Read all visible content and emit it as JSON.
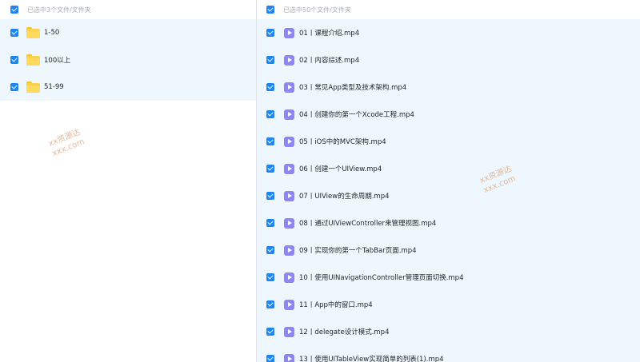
{
  "left": {
    "header": "已选中3个文件/文件夹",
    "items": [
      {
        "name": "1-50"
      },
      {
        "name": "100以上"
      },
      {
        "name": "51-99"
      }
    ]
  },
  "right": {
    "header": "已选中50个文件/文件夹",
    "items": [
      {
        "name": "01丨课程介绍.mp4"
      },
      {
        "name": "02丨内容综述.mp4"
      },
      {
        "name": "03丨常见App类型及技术架构.mp4"
      },
      {
        "name": "04丨创建你的第一个Xcode工程.mp4"
      },
      {
        "name": "05丨iOS中的MVC架构.mp4"
      },
      {
        "name": "06丨创建一个UIView.mp4"
      },
      {
        "name": "07丨UIView的生命周期.mp4"
      },
      {
        "name": "08丨通过UIViewController来管理视图.mp4"
      },
      {
        "name": "09丨实现你的第一个TabBar页面.mp4"
      },
      {
        "name": "10丨使用UINavigationController管理页面切换.mp4"
      },
      {
        "name": "11丨App中的窗口.mp4"
      },
      {
        "name": "12丨delegate设计模式.mp4"
      },
      {
        "name": "13丨使用UITableView实现简单的列表(1).mp4"
      }
    ]
  },
  "watermark": {
    "line1": "xx资源达",
    "line2": "xxx.com"
  },
  "colors": {
    "accent": "#1e86f4",
    "list_bg": "#eef7fd",
    "folder": "#fcd24b",
    "video_icon": "#8d86f3"
  }
}
